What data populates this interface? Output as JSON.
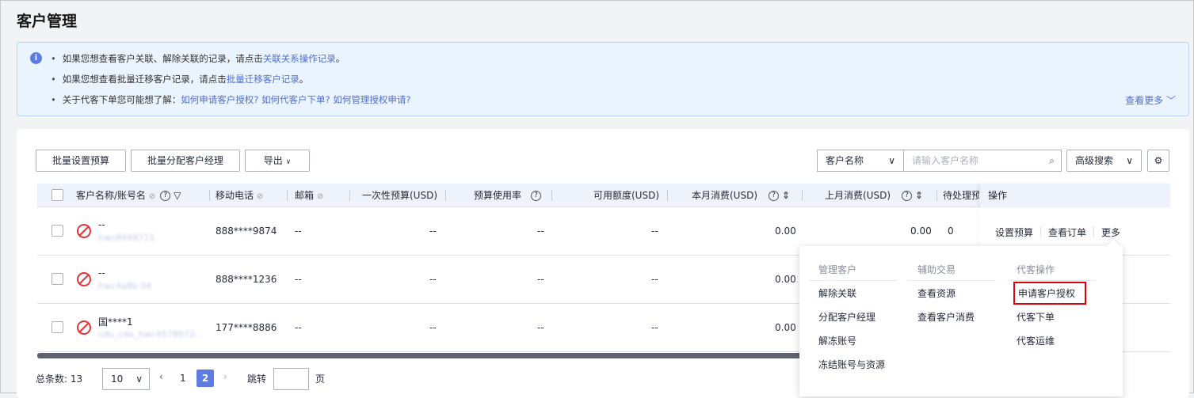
{
  "title": "客户管理",
  "notice": {
    "line1": {
      "text": "如果您想查看客户关联、解除关联的记录，请点击",
      "link": "关联关系操作记录",
      "end": "。"
    },
    "line2": {
      "text": "如果您想查看批量迁移客户记录，请点击",
      "link": "批量迁移客户记录",
      "end": "。"
    },
    "line3": {
      "text": "关于代客下单您可能想了解：",
      "links": [
        "如何申请客户授权?",
        "如何代客户下单?",
        "如何管理授权申请?"
      ]
    },
    "more": "查看更多"
  },
  "toolbar": {
    "batch_budget": "批量设置预算",
    "batch_manager": "批量分配客户经理",
    "export": "导出",
    "search_field": "客户名称",
    "search_placeholder": "请输入客户名称",
    "advanced": "高级搜索"
  },
  "columns": [
    "客户名称/账号名",
    "移动电话",
    "邮箱",
    "一次性预算(USD)",
    "预算使用率",
    "可用额度(USD)",
    "本月消费(USD)",
    "上月消费(USD)",
    "待处理预",
    "操作"
  ],
  "rows": [
    {
      "name": "--",
      "account": "hwc84X8711",
      "phone": "888****9874",
      "email": "--",
      "budget": "--",
      "usage": "--",
      "available": "--",
      "this_month": "0.00",
      "last_month": "0.00",
      "pending": "0"
    },
    {
      "name": "--",
      "account": "hwc4a8b 04",
      "phone": "888****1236",
      "email": "--",
      "budget": "--",
      "usage": "--",
      "available": "--",
      "this_month": "0.00"
    },
    {
      "name": "国****1",
      "account": "cdu_cde_hwc4578072...",
      "phone": "177****8886",
      "email": "--",
      "budget": "--",
      "usage": "--",
      "available": "--",
      "this_month": "0.00"
    }
  ],
  "actions": {
    "set_budget": "设置预算",
    "view_orders": "查看订单",
    "more": "更多"
  },
  "menu": {
    "groups": [
      {
        "title": "管理客户",
        "items": [
          "解除关联",
          "分配客户经理",
          "解冻账号",
          "冻结账号与资源"
        ]
      },
      {
        "title": "辅助交易",
        "items": [
          "查看资源",
          "查看客户消费"
        ]
      },
      {
        "title": "代客操作",
        "items": [
          "申请客户授权",
          "代客下单",
          "代客运维"
        ]
      }
    ]
  },
  "pagination": {
    "total_label": "总条数:",
    "total": "13",
    "page_size": "10",
    "pages": [
      "1",
      "2"
    ],
    "current": "2",
    "jump": "跳转",
    "page_unit": "页"
  }
}
